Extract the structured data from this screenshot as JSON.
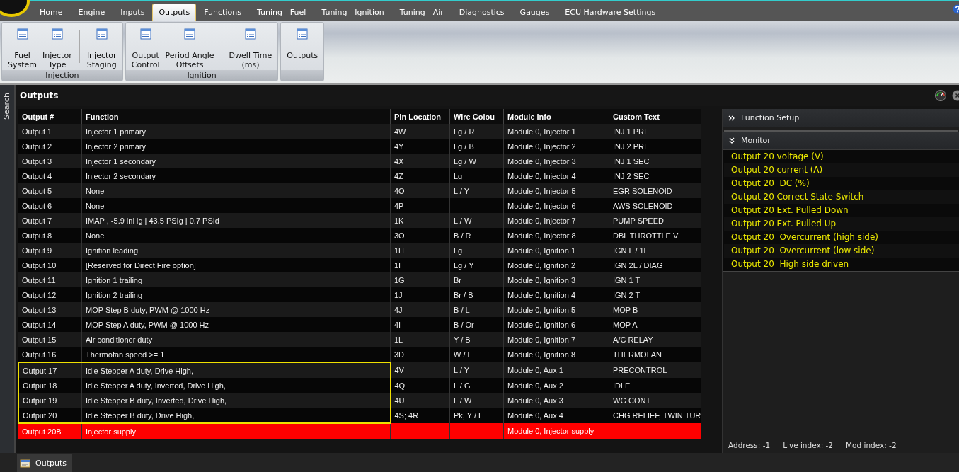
{
  "tabs": [
    {
      "label": "Home",
      "selected": false
    },
    {
      "label": "Engine",
      "selected": false
    },
    {
      "label": "Inputs",
      "selected": false
    },
    {
      "label": "Outputs",
      "selected": true
    },
    {
      "label": "Functions",
      "selected": false
    },
    {
      "label": "Tuning - Fuel",
      "selected": false
    },
    {
      "label": "Tuning - Ignition",
      "selected": false
    },
    {
      "label": "Tuning - Air",
      "selected": false
    },
    {
      "label": "Diagnostics",
      "selected": false
    },
    {
      "label": "Gauges",
      "selected": false
    },
    {
      "label": "ECU Hardware Settings",
      "selected": false
    }
  ],
  "ribbon_groups": [
    {
      "title": "Injection",
      "buttons": [
        [
          "Fuel",
          "System"
        ],
        [
          "Injector",
          "Type"
        ],
        [
          "Injector",
          "Staging"
        ]
      ],
      "separator": true
    },
    {
      "title": "Ignition",
      "buttons": [
        [
          "Output",
          "Control"
        ],
        [
          "Period Angle",
          "Offsets"
        ],
        [
          "Dwell Time",
          "(ms)"
        ]
      ],
      "separator": true
    },
    {
      "buttons": [
        [
          "Outputs"
        ]
      ]
    }
  ],
  "side_tab": "Search",
  "panel_title": "Outputs",
  "table": {
    "columns": [
      "Output #",
      "Function",
      "Pin Location",
      "Wire Colou",
      "Module Info",
      "Custom Text"
    ],
    "rows": [
      {
        "cells": [
          "Output 1",
          "Injector 1 primary",
          "4W",
          "Lg / R",
          "Module 0, Injector 1",
          "INJ 1 PRI"
        ],
        "highlighted": false,
        "alert": false
      },
      {
        "cells": [
          "Output 2",
          "Injector 2 primary",
          "4Y",
          "Lg / B",
          "Module 0, Injector 2",
          "INJ 2 PRI"
        ],
        "highlighted": false,
        "alert": false
      },
      {
        "cells": [
          "Output 3",
          "Injector 1 secondary",
          "4X",
          "Lg / W",
          "Module 0, Injector 3",
          "INJ 1 SEC"
        ],
        "highlighted": false,
        "alert": false
      },
      {
        "cells": [
          "Output 4",
          "Injector 2 secondary",
          "4Z",
          "Lg",
          "Module 0, Injector 4",
          "INJ 2 SEC"
        ],
        "highlighted": false,
        "alert": false
      },
      {
        "cells": [
          "Output 5",
          "None",
          "4O",
          "L / Y",
          "Module 0, Injector 5",
          "EGR SOLENOID"
        ],
        "highlighted": false,
        "alert": false
      },
      {
        "cells": [
          "Output 6",
          "None",
          "4P",
          "",
          "Module 0, Injector 6",
          "AWS SOLENOID"
        ],
        "highlighted": false,
        "alert": false
      },
      {
        "cells": [
          "Output 7",
          "IMAP , -5.9 inHg | 43.5 PSIg | 0.7 PSId",
          "1K",
          "L / W",
          "Module 0, Injector 7",
          "PUMP SPEED"
        ],
        "highlighted": false,
        "alert": false
      },
      {
        "cells": [
          "Output 8",
          "None",
          "3O",
          "B / R",
          "Module 0, Injector 8",
          "DBL THROTTLE V"
        ],
        "highlighted": false,
        "alert": false
      },
      {
        "cells": [
          "Output 9",
          "Ignition leading",
          "1H",
          "Lg",
          "Module 0, Ignition 1",
          "IGN L / 1L"
        ],
        "highlighted": false,
        "alert": false
      },
      {
        "cells": [
          "Output 10",
          "[Reserved for Direct Fire option]",
          "1I",
          "Lg / Y",
          "Module 0, Ignition 2",
          "IGN 2L / DIAG"
        ],
        "highlighted": false,
        "alert": false
      },
      {
        "cells": [
          "Output 11",
          "Ignition 1 trailing",
          "1G",
          "Br",
          "Module 0, Ignition 3",
          "IGN 1 T"
        ],
        "highlighted": false,
        "alert": false
      },
      {
        "cells": [
          "Output 12",
          "Ignition 2 trailing",
          "1J",
          "Br / B",
          "Module 0, Ignition 4",
          "IGN 2 T"
        ],
        "highlighted": false,
        "alert": false
      },
      {
        "cells": [
          "Output 13",
          "MOP Step B duty, PWM @ 1000 Hz",
          "4J",
          "B / L",
          "Module 0, Ignition 5",
          "MOP B"
        ],
        "highlighted": false,
        "alert": false
      },
      {
        "cells": [
          "Output 14",
          "MOP Step A duty, PWM @ 1000 Hz",
          "4I",
          "B / Or",
          "Module 0, Ignition 6",
          "MOP A"
        ],
        "highlighted": false,
        "alert": false
      },
      {
        "cells": [
          "Output 15",
          "Air conditioner duty",
          "1L",
          "Y / B",
          "Module 0, Ignition 7",
          "A/C RELAY"
        ],
        "highlighted": false,
        "alert": false
      },
      {
        "cells": [
          "Output 16",
          "Thermofan speed >= 1",
          "3D",
          "W / L",
          "Module 0, Ignition 8",
          "THERMOFAN"
        ],
        "highlighted": false,
        "alert": false
      },
      {
        "cells": [
          "Output 17",
          "Idle Stepper A duty, Drive High,",
          "4V",
          "L / Y",
          "Module 0, Aux 1",
          "PRECONTROL"
        ],
        "highlighted": true,
        "alert": false
      },
      {
        "cells": [
          "Output 18",
          "Idle Stepper A duty, Inverted, Drive High,",
          "4Q",
          "L / G",
          "Module 0, Aux 2",
          "IDLE"
        ],
        "highlighted": true,
        "alert": false
      },
      {
        "cells": [
          "Output 19",
          "Idle Stepper B duty, Inverted, Drive High,",
          "4U",
          "L / W",
          "Module 0, Aux 3",
          "WG CONT"
        ],
        "highlighted": true,
        "alert": false
      },
      {
        "cells": [
          "Output 20",
          "Idle Stepper B duty, Drive High,",
          "4S; 4R",
          "Pk, Y / L",
          "Module 0, Aux 4",
          "CHG RELIEF, TWIN TUR"
        ],
        "highlighted": true,
        "alert": false
      },
      {
        "cells": [
          "Output 20B",
          "Injector supply",
          "",
          "",
          "Module 0, Injector supply",
          ""
        ],
        "highlighted": false,
        "alert": true
      }
    ]
  },
  "sections": [
    {
      "title": "Function Setup",
      "expanded": false
    },
    {
      "title": "Monitor",
      "expanded": true
    }
  ],
  "monitor": [
    "Output 20 voltage (V)",
    "Output 20 current (A)",
    "Output 20  DC (%)",
    "Output 20 Correct State Switch",
    "Output 20 Ext. Pulled Down",
    "Output 20 Ext. Pulled Up",
    "Output 20  Overcurrent (high side)",
    "Output 20  Overcurrent (low side)",
    "Output 20  High side driven"
  ],
  "status": [
    "Address: -1",
    "Live index: -2",
    "Mod index: -2"
  ],
  "bottom_tab": "Outputs"
}
